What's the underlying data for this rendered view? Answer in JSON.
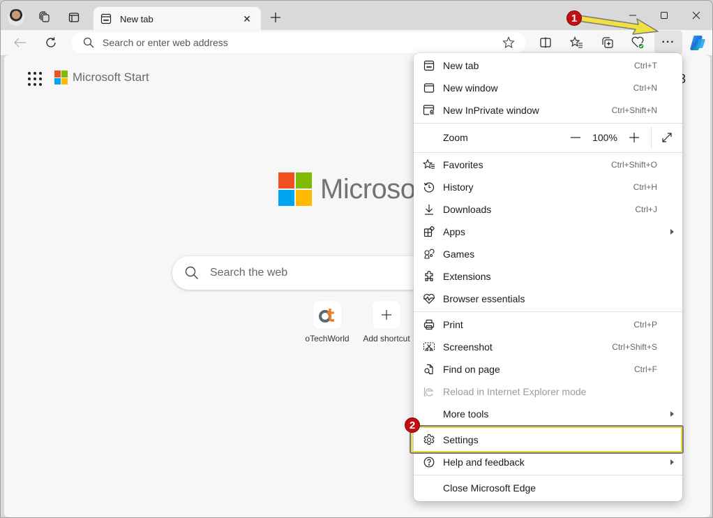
{
  "browser": {
    "tab": {
      "title": "New tab",
      "icon": "new-tab-page-icon"
    },
    "window_controls": {
      "minimize": "minimize-icon",
      "maximize": "maximize-icon",
      "close": "close-icon"
    },
    "address_bar": {
      "placeholder": "Search or enter web address",
      "value": ""
    },
    "toolbar_icons": [
      "split-screen-icon",
      "favorites-icon",
      "collections-icon",
      "browser-essentials-icon",
      "more-icon",
      "copilot-icon"
    ],
    "more_button_label": "···"
  },
  "page": {
    "header": {
      "brand": "Microsoft Start",
      "apps_icon": "apps-grid-icon"
    },
    "logo_text": "Microsoft",
    "search": {
      "placeholder": "Search the web",
      "value": ""
    },
    "shortcuts": [
      {
        "label": "oTechWorld",
        "icon": "otechworld-logo"
      },
      {
        "label": "Add shortcut",
        "icon": "plus-icon"
      }
    ],
    "logo_colors": [
      "#f25022",
      "#7fba00",
      "#00a4ef",
      "#ffb900"
    ]
  },
  "menu": {
    "items": [
      {
        "label": "New tab",
        "shortcut": "Ctrl+T",
        "icon": "new-tab-icon"
      },
      {
        "label": "New window",
        "shortcut": "Ctrl+N",
        "icon": "new-window-icon"
      },
      {
        "label": "New InPrivate window",
        "shortcut": "Ctrl+Shift+N",
        "icon": "inprivate-icon"
      },
      {
        "label": "Zoom",
        "value": "100%",
        "minus": "—",
        "plus": "+"
      },
      {
        "label": "Favorites",
        "shortcut": "Ctrl+Shift+O",
        "icon": "favorites-icon"
      },
      {
        "label": "History",
        "shortcut": "Ctrl+H",
        "icon": "history-icon"
      },
      {
        "label": "Downloads",
        "shortcut": "Ctrl+J",
        "icon": "download-icon"
      },
      {
        "label": "Apps",
        "shortcut": "",
        "icon": "apps-icon",
        "submenu": true
      },
      {
        "label": "Games",
        "shortcut": "",
        "icon": "games-icon"
      },
      {
        "label": "Extensions",
        "shortcut": "",
        "icon": "extensions-icon"
      },
      {
        "label": "Browser essentials",
        "shortcut": "",
        "icon": "heart-pulse-icon"
      },
      {
        "label": "Print",
        "shortcut": "Ctrl+P",
        "icon": "print-icon"
      },
      {
        "label": "Screenshot",
        "shortcut": "Ctrl+Shift+S",
        "icon": "screenshot-icon"
      },
      {
        "label": "Find on page",
        "shortcut": "Ctrl+F",
        "icon": "find-icon"
      },
      {
        "label": "Reload in Internet Explorer mode",
        "shortcut": "",
        "icon": "ie-icon",
        "disabled": true
      },
      {
        "label": "More tools",
        "shortcut": "",
        "submenu": true
      },
      {
        "label": "Settings",
        "shortcut": "",
        "icon": "gear-icon",
        "highlighted": true
      },
      {
        "label": "Help and feedback",
        "shortcut": "",
        "icon": "help-icon",
        "submenu": true
      },
      {
        "label": "Close Microsoft Edge",
        "shortcut": ""
      }
    ]
  },
  "annotations": {
    "step1": "1",
    "step2": "2",
    "highlight_color": "#e8da3a",
    "badge_color": "#c40e12",
    "arrow_color": "#f0e040"
  }
}
